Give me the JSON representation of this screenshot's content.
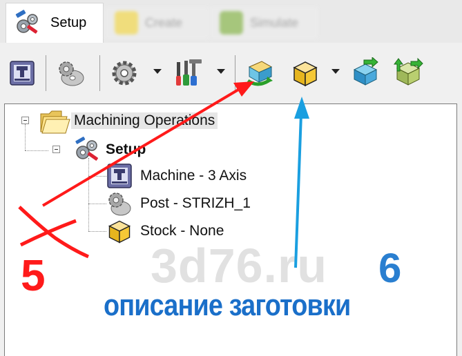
{
  "tabs": {
    "active": {
      "label": "Setup",
      "icon": "setup-gears-icon"
    },
    "others": [
      {
        "label": "Create"
      },
      {
        "label": "Simulate"
      }
    ]
  },
  "toolbar": {
    "buttons": [
      {
        "name": "machine-button",
        "icon": "machine-icon"
      },
      {
        "name": "post-processor-button",
        "icon": "post-disc-gear-icon"
      },
      {
        "name": "settings-button",
        "icon": "gear-icon",
        "dropdown": true
      },
      {
        "name": "tools-button",
        "icon": "tools-icon",
        "dropdown": true
      },
      {
        "name": "stock-wizard-button",
        "icon": "stock-wizard-icon"
      },
      {
        "name": "stock-box-button",
        "icon": "stock-box-icon",
        "dropdown": true
      },
      {
        "name": "align-part-button",
        "icon": "align-part-icon"
      },
      {
        "name": "transform-stock-button",
        "icon": "transform-stock-icon"
      }
    ]
  },
  "tree": {
    "root": {
      "label": "Machining Operations"
    },
    "setup": {
      "label": "Setup"
    },
    "children": [
      {
        "label": "Machine - 3 Axis",
        "icon": "machine-icon"
      },
      {
        "label": "Post - STRIZH_1",
        "icon": "post-gear-icon"
      },
      {
        "label": "Stock - None",
        "icon": "stock-box-icon"
      }
    ]
  },
  "annotations": {
    "watermark": "3d76.ru",
    "step5": "5",
    "step6": "6",
    "caption": "описание заготовки",
    "colors": {
      "red": "#ff1a1a",
      "blue": "#1a9fe0",
      "caption": "#1a6fc9"
    }
  }
}
